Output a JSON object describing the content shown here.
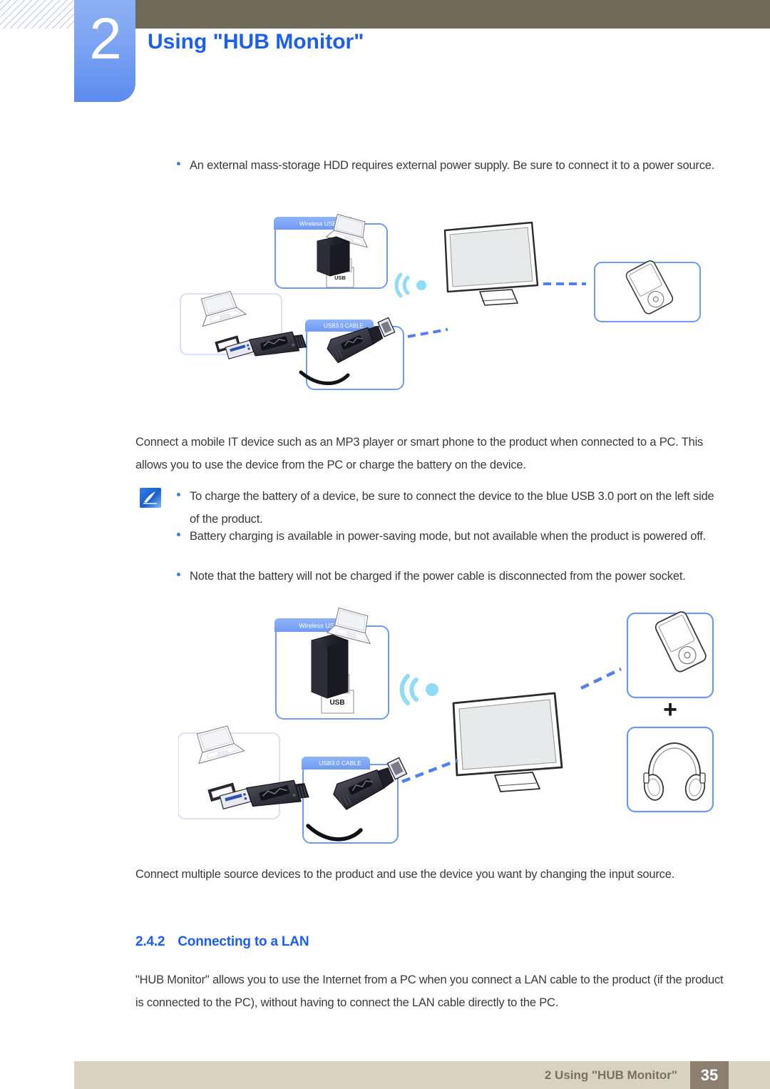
{
  "header": {
    "chapter_number": "2",
    "title": "Using \"HUB Monitor\"",
    "olive_bar_color": "#6d6b58",
    "accent_blue": "#1a5ff0"
  },
  "content": {
    "top_bullets": [
      "An external mass-storage HDD requires external power supply. Be sure to connect it to a power source."
    ],
    "paragraph_1": "Connect a mobile IT device such as an MP3 player or smart phone to the product when connected to a PC. This allows you to use the device from the PC or charge the battery on the device.",
    "note_bullets": [
      "To charge the battery of a device, be sure to connect the device to the blue USB 3.0 port on the left side of the product.",
      "Battery charging is available in power-saving mode, but not available when the product is powered off.",
      "Note that the battery will not be charged if the power cable is disconnected from the power socket."
    ],
    "paragraph_2": "Connect multiple source devices to the product and use the device you want by changing the input source.",
    "section": {
      "number": "2.4.2",
      "title": "Connecting to a LAN"
    },
    "paragraph_3": "\"HUB Monitor\" allows you to use the Internet from a PC when you connect a LAN cable to the product (if the product is connected to the PC), without having to connect the LAN cable directly to the PC."
  },
  "diagram_1": {
    "label_wireless_usb": "Wireless USB",
    "label_usb_cable": "USB3.0 CABLE",
    "dongle_label": "USB"
  },
  "diagram_2": {
    "label_wireless_usb": "Wireless USB",
    "label_usb_cable": "USB3.0 CABLE",
    "dongle_label": "USB",
    "plus_sign": "+"
  },
  "footer": {
    "text": "2 Using \"HUB Monitor\"",
    "page_number": "35",
    "bar_color": "#d7d3c0",
    "page_box_color": "#8d7f70"
  }
}
